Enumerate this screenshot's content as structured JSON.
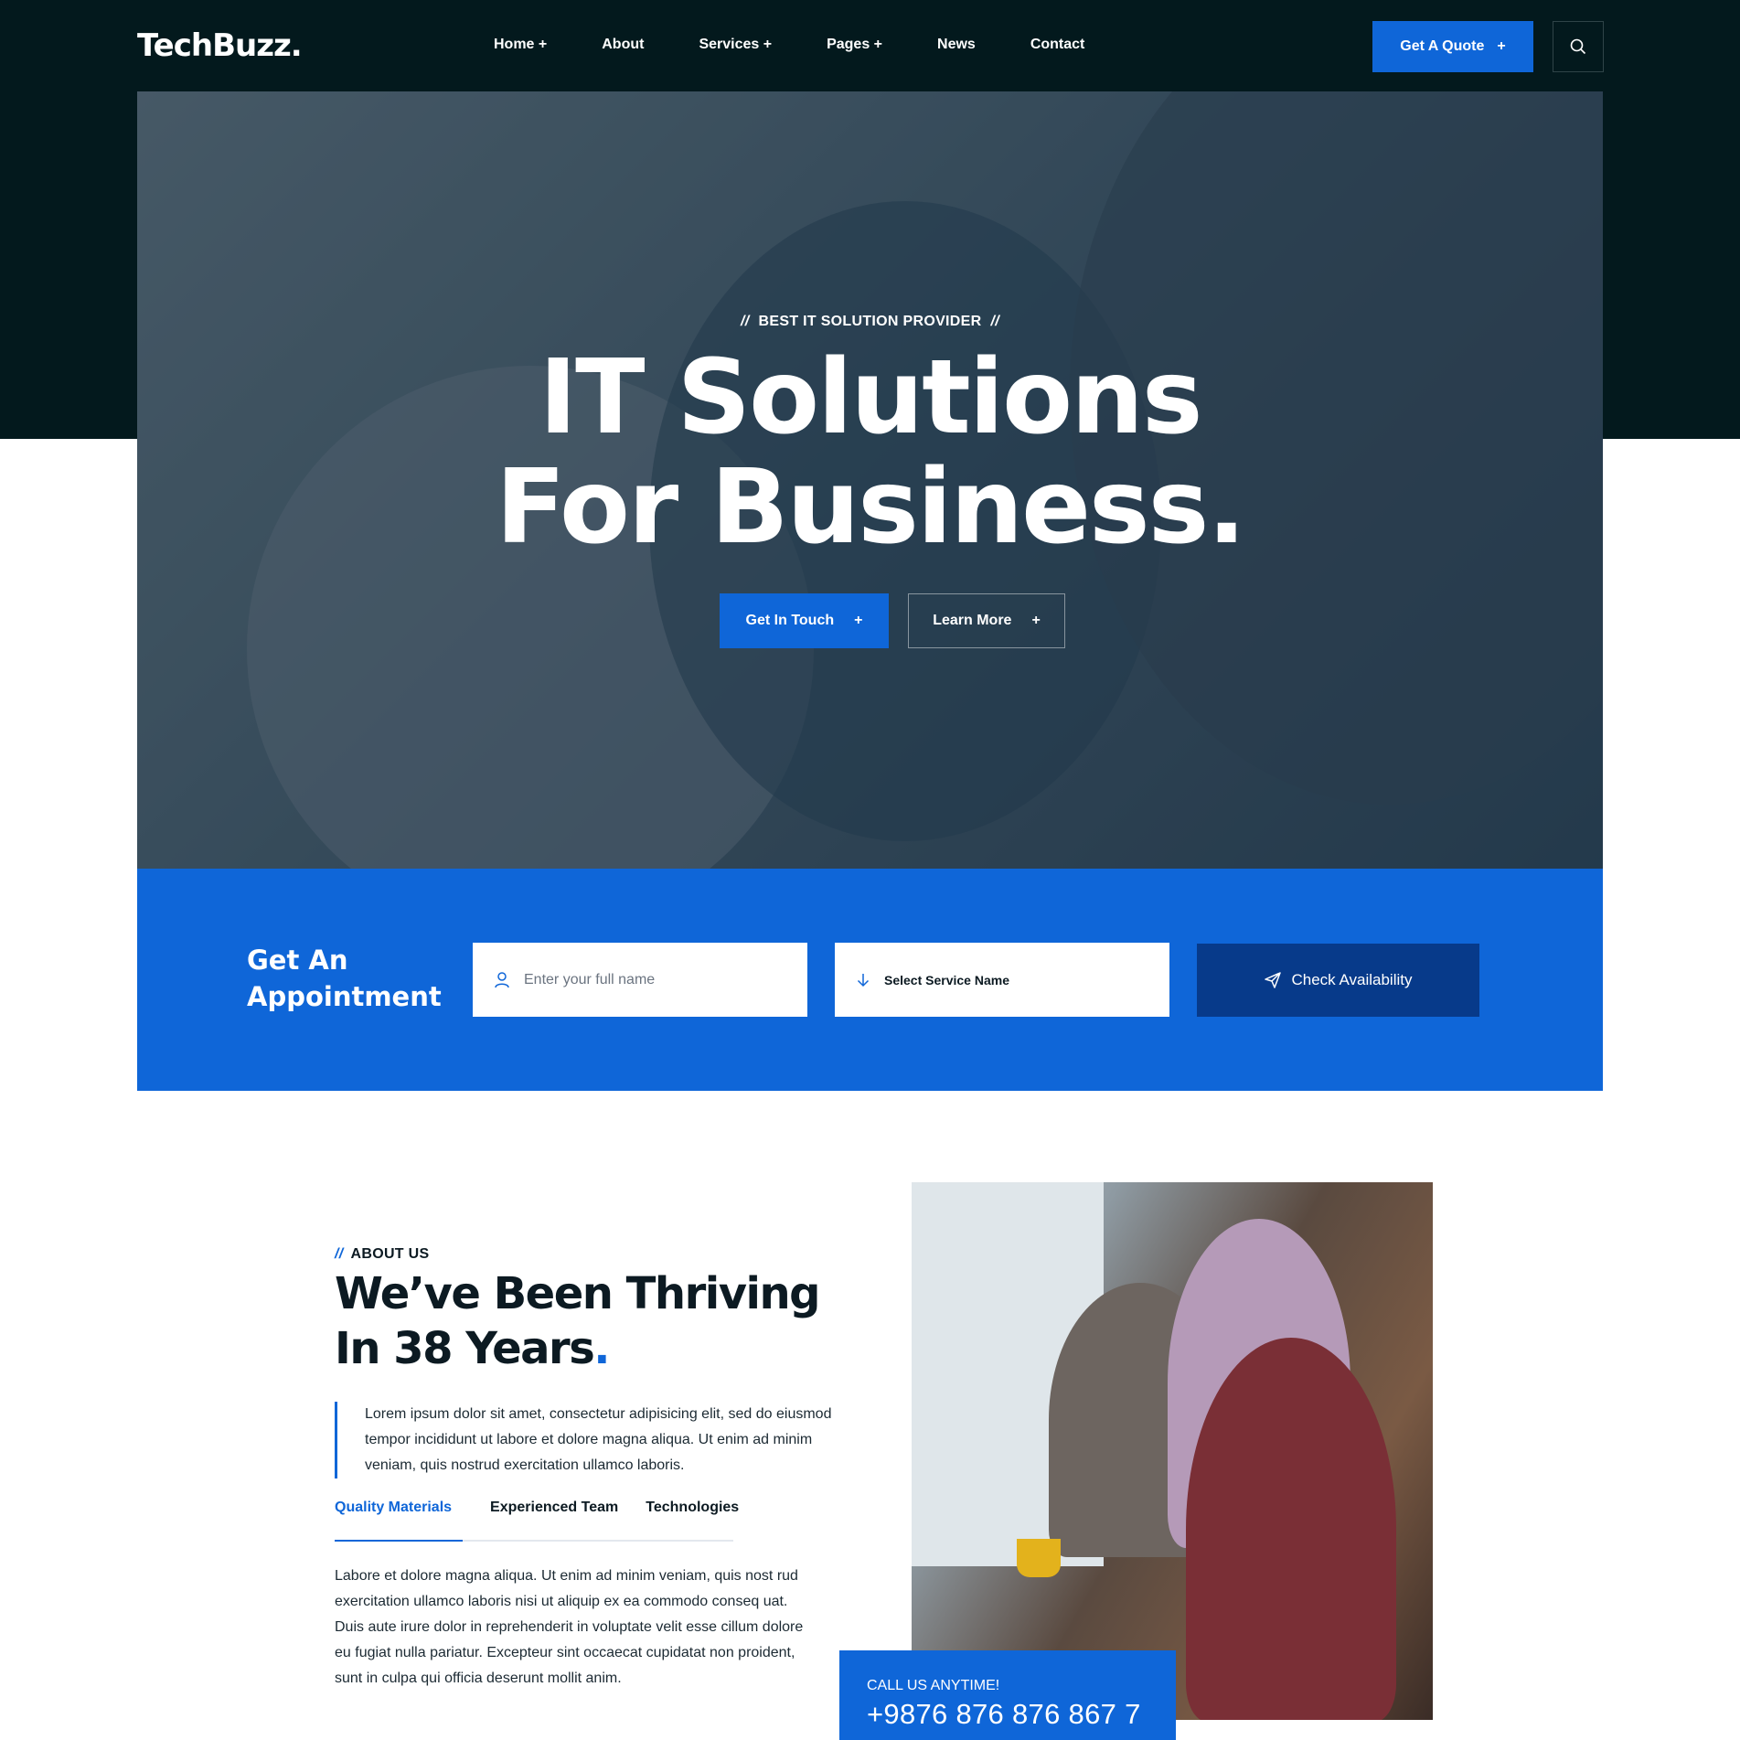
{
  "header": {
    "logo": "TechBuzz.",
    "nav": [
      {
        "label": "Home +"
      },
      {
        "label": "About"
      },
      {
        "label": "Services +"
      },
      {
        "label": "Pages +"
      },
      {
        "label": "News"
      },
      {
        "label": "Contact"
      }
    ],
    "quote_label": "Get A Quote",
    "quote_icon": "+"
  },
  "hero": {
    "kicker": "BEST IT SOLUTION PROVIDER",
    "kicker_slash": "//",
    "title_line1": "IT Solutions",
    "title_line2": "For Business.",
    "primary_btn": "Get In Touch",
    "secondary_btn": "Learn More",
    "btn_icon": "+"
  },
  "appointment": {
    "title_line1": "Get An",
    "title_line2": "Appointment",
    "name_placeholder": "Enter your full name",
    "service_label": "Select Service Name",
    "check_label": "Check Availability"
  },
  "about": {
    "kicker_slash": "//",
    "kicker": "ABOUT US",
    "title_text": "We’ve Been Thriving In 38 Years",
    "title_dot": ".",
    "quote": "Lorem ipsum dolor sit amet, consectetur adipisicing elit, sed do eiusmod tempor incididunt ut labore et dolore magna aliqua. Ut enim ad minim veniam, quis nostrud exercitation ullamco laboris.",
    "tabs": [
      {
        "label": "Quality Materials",
        "active": true
      },
      {
        "label": "Experienced Team",
        "active": false
      },
      {
        "label": "Technologies",
        "active": false
      }
    ],
    "tab_body": "Labore et dolore magna aliqua. Ut enim ad minim veniam, quis nost rud exercitation ullamco laboris nisi ut aliquip ex ea commodo conseq uat. Duis aute irure dolor in reprehenderit in voluptate velit esse cillum dolore eu fugiat nulla pariatur. Excepteur sint occaecat cupidatat non proident, sunt in culpa qui officia deserunt mollit anim."
  },
  "contact_box": {
    "label": "CALL US ANYTIME!",
    "phone": "+9876 876 876 867 7"
  },
  "colors": {
    "accent": "#0f66d8",
    "dark": "#03191d",
    "deep_blue": "#073a8a"
  },
  "icons": [
    "search-icon",
    "user-icon",
    "arrow-down-icon",
    "send-icon"
  ]
}
